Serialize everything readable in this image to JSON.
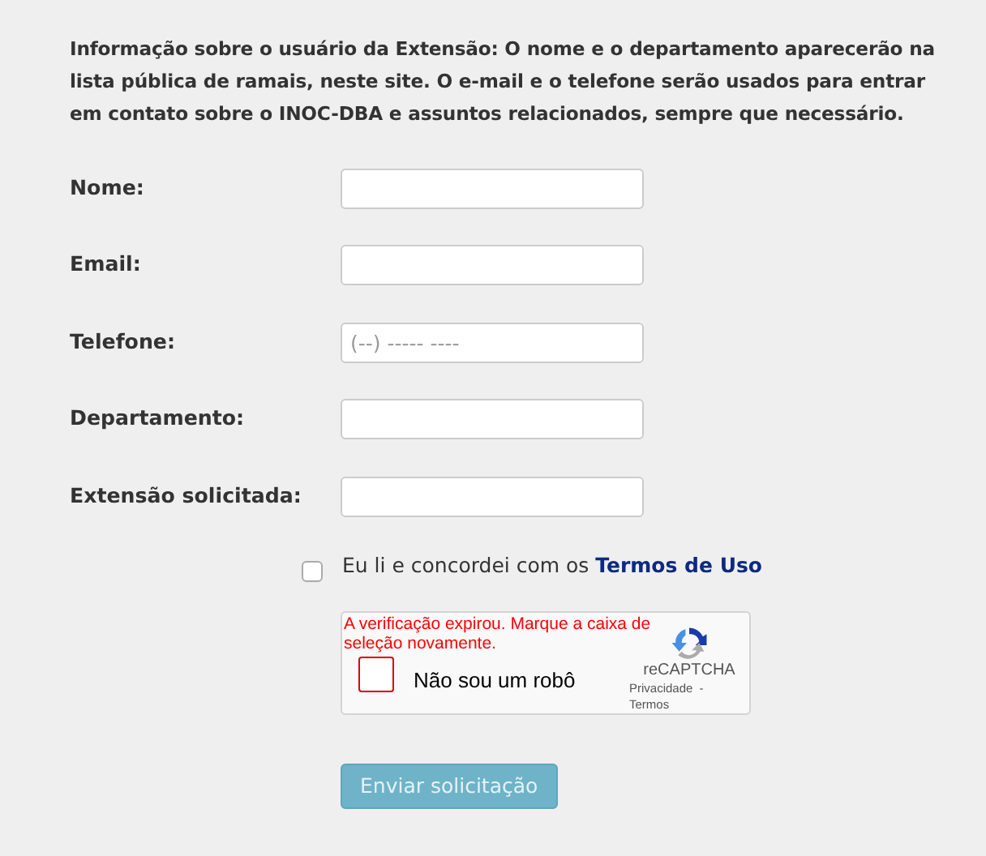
{
  "intro": "Informação sobre o usuário da Extensão: O nome e o departamento aparecerão na lista pública de ramais, neste site. O e-mail e o telefone serão usados para entrar em contato sobre o INOC-DBA e assuntos relacionados, sempre que necessário.",
  "fields": [
    {
      "label": "Nome:"
    },
    {
      "label": "Email:"
    },
    {
      "label": "Telefone:",
      "placeholder": "(--) ----- ----"
    },
    {
      "label": "Departamento:"
    },
    {
      "label": "Extensão solicitada:"
    }
  ],
  "terms": {
    "checked": false,
    "text": "Eu li e concordei com os",
    "link": "Termos de Uso"
  },
  "captcha": {
    "error": "A verificação expirou. Marque a caixa de seleção novamente.",
    "checked": false,
    "label": "Não sou um robô",
    "brand": "reCAPTCHA",
    "privacy": "Privacidade",
    "separator": "-",
    "terms": "Termos"
  },
  "submit": {
    "label": "Enviar solicitação",
    "disabled": true
  }
}
